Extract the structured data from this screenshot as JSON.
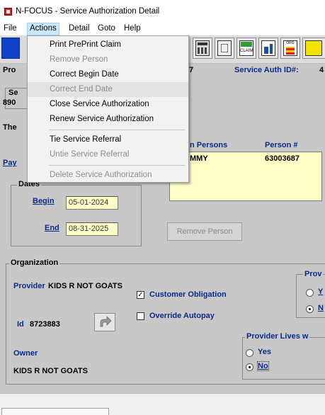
{
  "window": {
    "title": "N-FOCUS - Service Authorization Detail"
  },
  "menubar": [
    "File",
    "Actions",
    "Detail",
    "Goto",
    "Help"
  ],
  "toolbar": {
    "claim_label": "CLAIM",
    "org_label": "ORG"
  },
  "actions_menu": {
    "items": [
      {
        "label": "Print PrePrint Claim",
        "enabled": true
      },
      {
        "label": "Remove Person",
        "enabled": false
      },
      {
        "label": "Correct Begin Date",
        "enabled": true
      },
      {
        "label": "Correct End Date",
        "enabled": false
      },
      {
        "label": "Close Service Authorization",
        "enabled": true
      },
      {
        "label": "Renew Service Authorization",
        "enabled": true
      },
      {
        "label": "Tie Service Referral",
        "enabled": true
      },
      {
        "label": "Untie Service Referral",
        "enabled": false
      },
      {
        "label": "Delete Service Authorization",
        "enabled": false
      }
    ]
  },
  "header": {
    "left_partial": "Pro",
    "number_partial": "7",
    "service_auth_label": "Service Auth ID#:",
    "service_auth_value_partial": "4"
  },
  "left_partials": {
    "se": "Se",
    "num": "890",
    "the": "The",
    "pay": "Pay"
  },
  "persons": {
    "col_persons": "n Persons",
    "col_person_num": "Person #",
    "rows": [
      {
        "name": "MMY",
        "number": "63003687"
      }
    ],
    "remove_button": "Remove Person"
  },
  "dates": {
    "group_title": "Dates",
    "begin_label": "Begin",
    "begin_value": "05-01-2024",
    "end_label": "End",
    "end_value": "08-31-2025"
  },
  "organization": {
    "group_title": "Organization",
    "provider_label": "Provider",
    "provider_value": "KIDS R NOT GOATS",
    "id_label": "Id",
    "id_value": "8723883",
    "owner_label": "Owner",
    "owner_value": "KIDS R NOT GOATS",
    "customer_obligation_label": "Customer Obligation",
    "customer_obligation_checked": true,
    "override_autopay_label": "Override Autopay",
    "override_autopay_checked": false
  },
  "prov_group": {
    "title_partial": "Prov",
    "opt_yes_partial": "Y",
    "opt_no_partial": "N"
  },
  "provider_lives": {
    "title_partial": "Provider Lives w",
    "yes_label": "Yes",
    "no_label": "No",
    "selected": "No"
  }
}
